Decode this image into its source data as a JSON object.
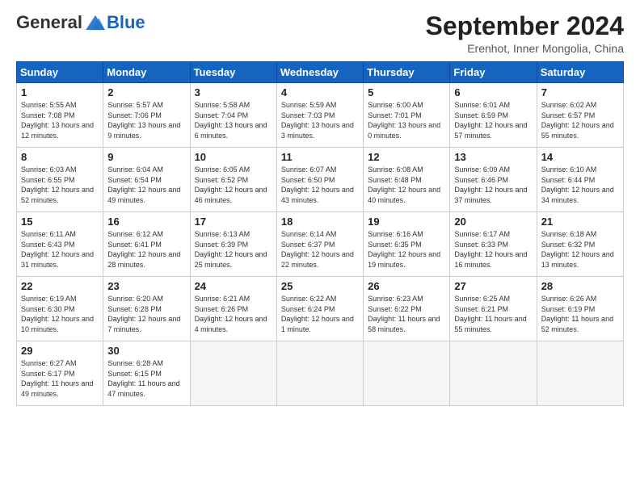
{
  "header": {
    "logo_general": "General",
    "logo_blue": "Blue",
    "month_title": "September 2024",
    "location": "Erenhot, Inner Mongolia, China"
  },
  "days_of_week": [
    "Sunday",
    "Monday",
    "Tuesday",
    "Wednesday",
    "Thursday",
    "Friday",
    "Saturday"
  ],
  "weeks": [
    [
      {
        "day": "1",
        "sunrise": "5:55 AM",
        "sunset": "7:08 PM",
        "daylight": "13 hours and 12 minutes."
      },
      {
        "day": "2",
        "sunrise": "5:57 AM",
        "sunset": "7:06 PM",
        "daylight": "13 hours and 9 minutes."
      },
      {
        "day": "3",
        "sunrise": "5:58 AM",
        "sunset": "7:04 PM",
        "daylight": "13 hours and 6 minutes."
      },
      {
        "day": "4",
        "sunrise": "5:59 AM",
        "sunset": "7:03 PM",
        "daylight": "13 hours and 3 minutes."
      },
      {
        "day": "5",
        "sunrise": "6:00 AM",
        "sunset": "7:01 PM",
        "daylight": "13 hours and 0 minutes."
      },
      {
        "day": "6",
        "sunrise": "6:01 AM",
        "sunset": "6:59 PM",
        "daylight": "12 hours and 57 minutes."
      },
      {
        "day": "7",
        "sunrise": "6:02 AM",
        "sunset": "6:57 PM",
        "daylight": "12 hours and 55 minutes."
      }
    ],
    [
      {
        "day": "8",
        "sunrise": "6:03 AM",
        "sunset": "6:55 PM",
        "daylight": "12 hours and 52 minutes."
      },
      {
        "day": "9",
        "sunrise": "6:04 AM",
        "sunset": "6:54 PM",
        "daylight": "12 hours and 49 minutes."
      },
      {
        "day": "10",
        "sunrise": "6:05 AM",
        "sunset": "6:52 PM",
        "daylight": "12 hours and 46 minutes."
      },
      {
        "day": "11",
        "sunrise": "6:07 AM",
        "sunset": "6:50 PM",
        "daylight": "12 hours and 43 minutes."
      },
      {
        "day": "12",
        "sunrise": "6:08 AM",
        "sunset": "6:48 PM",
        "daylight": "12 hours and 40 minutes."
      },
      {
        "day": "13",
        "sunrise": "6:09 AM",
        "sunset": "6:46 PM",
        "daylight": "12 hours and 37 minutes."
      },
      {
        "day": "14",
        "sunrise": "6:10 AM",
        "sunset": "6:44 PM",
        "daylight": "12 hours and 34 minutes."
      }
    ],
    [
      {
        "day": "15",
        "sunrise": "6:11 AM",
        "sunset": "6:43 PM",
        "daylight": "12 hours and 31 minutes."
      },
      {
        "day": "16",
        "sunrise": "6:12 AM",
        "sunset": "6:41 PM",
        "daylight": "12 hours and 28 minutes."
      },
      {
        "day": "17",
        "sunrise": "6:13 AM",
        "sunset": "6:39 PM",
        "daylight": "12 hours and 25 minutes."
      },
      {
        "day": "18",
        "sunrise": "6:14 AM",
        "sunset": "6:37 PM",
        "daylight": "12 hours and 22 minutes."
      },
      {
        "day": "19",
        "sunrise": "6:16 AM",
        "sunset": "6:35 PM",
        "daylight": "12 hours and 19 minutes."
      },
      {
        "day": "20",
        "sunrise": "6:17 AM",
        "sunset": "6:33 PM",
        "daylight": "12 hours and 16 minutes."
      },
      {
        "day": "21",
        "sunrise": "6:18 AM",
        "sunset": "6:32 PM",
        "daylight": "12 hours and 13 minutes."
      }
    ],
    [
      {
        "day": "22",
        "sunrise": "6:19 AM",
        "sunset": "6:30 PM",
        "daylight": "12 hours and 10 minutes."
      },
      {
        "day": "23",
        "sunrise": "6:20 AM",
        "sunset": "6:28 PM",
        "daylight": "12 hours and 7 minutes."
      },
      {
        "day": "24",
        "sunrise": "6:21 AM",
        "sunset": "6:26 PM",
        "daylight": "12 hours and 4 minutes."
      },
      {
        "day": "25",
        "sunrise": "6:22 AM",
        "sunset": "6:24 PM",
        "daylight": "12 hours and 1 minute."
      },
      {
        "day": "26",
        "sunrise": "6:23 AM",
        "sunset": "6:22 PM",
        "daylight": "11 hours and 58 minutes."
      },
      {
        "day": "27",
        "sunrise": "6:25 AM",
        "sunset": "6:21 PM",
        "daylight": "11 hours and 55 minutes."
      },
      {
        "day": "28",
        "sunrise": "6:26 AM",
        "sunset": "6:19 PM",
        "daylight": "11 hours and 52 minutes."
      }
    ],
    [
      {
        "day": "29",
        "sunrise": "6:27 AM",
        "sunset": "6:17 PM",
        "daylight": "11 hours and 49 minutes."
      },
      {
        "day": "30",
        "sunrise": "6:28 AM",
        "sunset": "6:15 PM",
        "daylight": "11 hours and 47 minutes."
      },
      null,
      null,
      null,
      null,
      null
    ]
  ]
}
